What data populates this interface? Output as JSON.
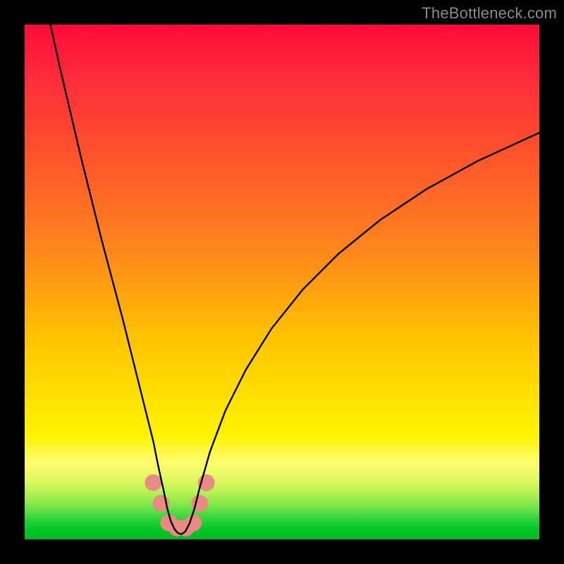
{
  "watermark": "TheBottleneck.com",
  "chart_data": {
    "type": "line",
    "title": "",
    "xlabel": "",
    "ylabel": "",
    "xlim": [
      0,
      100
    ],
    "ylim": [
      0,
      100
    ],
    "grid": false,
    "series": [
      {
        "name": "curve",
        "color": "#000000",
        "x": [
          5,
          7,
          9,
          11,
          13,
          15,
          17,
          19,
          20.5,
          22,
          23.5,
          25,
          26,
          27,
          27.7,
          28.4,
          29.1,
          29.8,
          30.5,
          31.2,
          32,
          33,
          34,
          36,
          39,
          43,
          48,
          54,
          61,
          69,
          78,
          88,
          100
        ],
        "values": [
          100,
          91,
          82.5,
          74,
          66,
          58,
          50.5,
          43,
          37,
          31,
          25,
          19,
          14,
          9.5,
          6,
          3.5,
          2,
          1.2,
          1,
          1.5,
          3,
          6,
          10,
          17,
          25,
          33,
          41,
          48.5,
          55.5,
          62,
          68,
          73.5,
          79
        ]
      }
    ],
    "markers": [
      {
        "name": "blob-cluster",
        "color": "#e98a84",
        "points_xy": [
          [
            25.0,
            11.0
          ],
          [
            26.5,
            7.0
          ],
          [
            28.0,
            3.2
          ],
          [
            29.6,
            2.2
          ],
          [
            31.3,
            2.2
          ],
          [
            32.8,
            3.2
          ],
          [
            34.0,
            7.0
          ],
          [
            35.3,
            11.0
          ]
        ],
        "radius_px": 12
      }
    ]
  },
  "colors": {
    "frame": "#000000",
    "watermark": "#8a8a8a",
    "curve": "#000000",
    "marker": "#e98a84"
  }
}
